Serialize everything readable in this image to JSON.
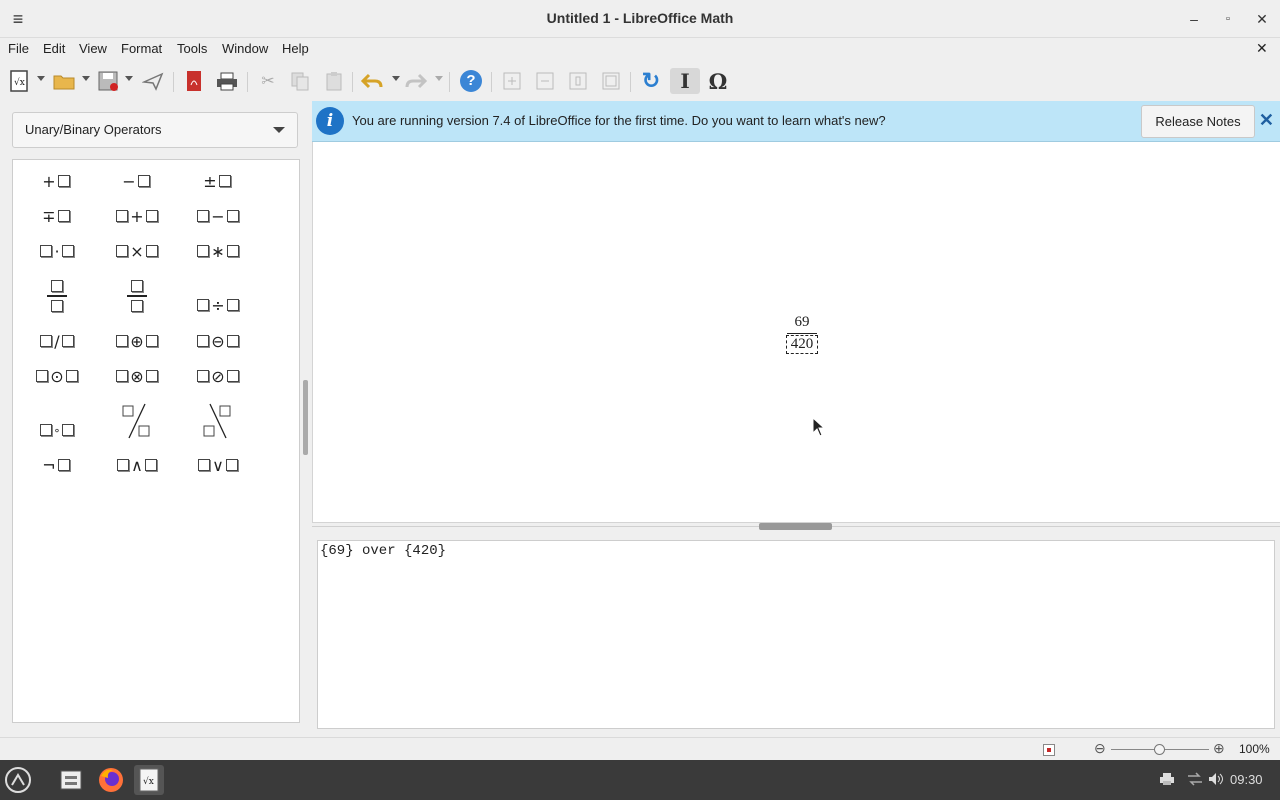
{
  "window": {
    "title": "Untitled 1 - LibreOffice Math",
    "hamburger_icon": "≡",
    "minimize": "–",
    "maximize": "▫",
    "close": "✕"
  },
  "menubar": {
    "items": [
      "File",
      "Edit",
      "View",
      "Format",
      "Tools",
      "Window",
      "Help"
    ],
    "close_doc": "✕"
  },
  "toolbar": {
    "icons": [
      "new-formula-icon",
      "open-icon",
      "save-icon",
      "send-icon",
      "export-pdf-icon",
      "print-icon",
      "cut-icon",
      "copy-icon",
      "paste-icon",
      "undo-icon",
      "redo-icon",
      "help-icon",
      "zoom-in-icon",
      "zoom-out-icon",
      "show-all-icon",
      "zoom-100-icon",
      "update-icon",
      "formula-cursor-icon",
      "symbols-icon"
    ],
    "help_glyph": "?",
    "update_glyph": "↻",
    "cursor_glyph": "I",
    "symbols_glyph": "Ω"
  },
  "sidebar": {
    "category": "Unary/Binary Operators",
    "elements": {
      "plus": "+",
      "minus": "−",
      "plusminus": "±",
      "minusplus": "∓",
      "add": "+",
      "sub": "−",
      "cdot": "·",
      "times": "×",
      "ast": "∗",
      "div": "÷",
      "slash": "/",
      "oplus": "⊕",
      "ominus": "⊖",
      "odot": "⊙",
      "otimes": "⊗",
      "odivide": "⊘",
      "circ": "∘",
      "neg": "¬",
      "and": "∧",
      "or": "∨"
    }
  },
  "infobar": {
    "message": "You are running version 7.4 of LibreOffice for the first time. Do you want to learn what's new?",
    "button": "Release Notes",
    "close": "✕"
  },
  "formula": {
    "numerator": "69",
    "denominator": "420"
  },
  "editor": {
    "text": "{69} over {420}"
  },
  "statusbar": {
    "zoom": "100%",
    "zoom_out": "⊖",
    "zoom_in": "⊕",
    "zoom_level": 1.0
  },
  "taskbar": {
    "clock": "09:30",
    "apps": [
      "start-menu-icon",
      "file-manager-icon",
      "firefox-icon",
      "libreoffice-math-icon"
    ]
  }
}
